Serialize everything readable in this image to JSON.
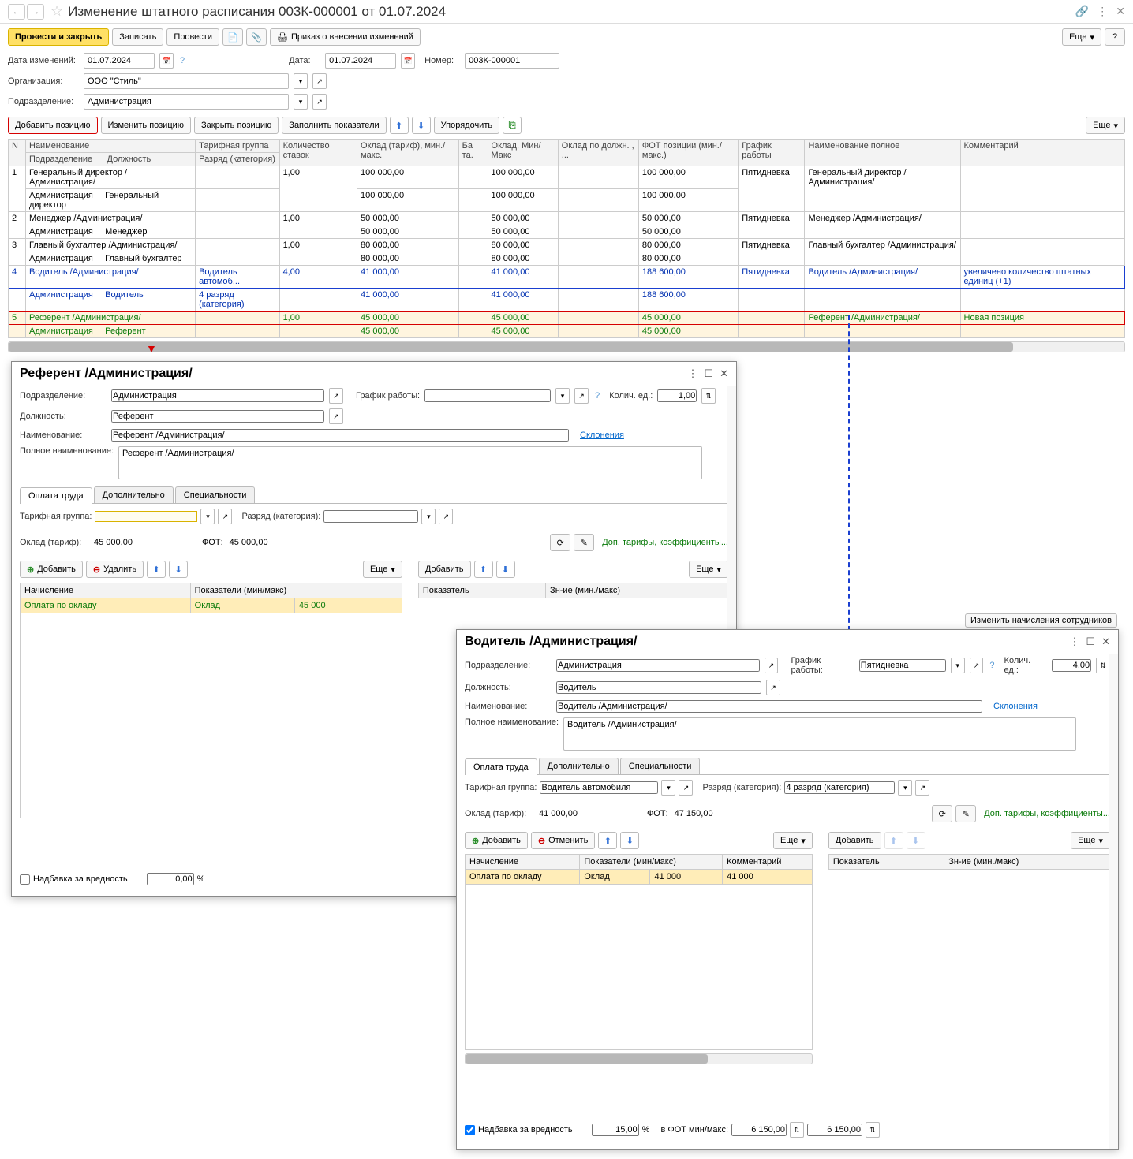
{
  "title": "Изменение штатного расписания 003К-000001 от 01.07.2024",
  "toolbar": {
    "post_close": "Провести и закрыть",
    "save": "Записать",
    "post": "Провести",
    "order": "Приказ о внесении изменений",
    "more": "Еще"
  },
  "fields": {
    "date_change_lbl": "Дата изменений:",
    "date_change_val": "01.07.2024",
    "date_lbl": "Дата:",
    "date_val": "01.07.2024",
    "number_lbl": "Номер:",
    "number_val": "003К-000001",
    "org_lbl": "Организация:",
    "org_val": "ООО \"Стиль\"",
    "dept_lbl": "Подразделение:",
    "dept_val": "Администрация"
  },
  "tb2": {
    "add_pos": "Добавить позицию",
    "edit_pos": "Изменить позицию",
    "close_pos": "Закрыть позицию",
    "fill_ind": "Заполнить показатели",
    "order": "Упорядочить",
    "more": "Еще"
  },
  "grid_head": {
    "n": "N",
    "name": "Наименование",
    "tariff": "Тарифная группа",
    "rates": "Количество ставок",
    "salary": "Оклад (тариф), мин./макс.",
    "base": "Ба та.",
    "sal_mm": "Оклад, Мин/Макс",
    "sal_pos": "Оклад по должн. , ...",
    "fot": "ФОТ позиции (мин./макс.)",
    "schedule": "График работы",
    "fullname": "Наименование полное",
    "comment": "Комментарий",
    "dept": "Подразделение",
    "position": "Должность",
    "rank": "Разряд (категория)"
  },
  "rows": [
    {
      "n": "1",
      "name": "Генеральный директор /Администрация/",
      "dept": "Администрация",
      "pos": "Генеральный директор",
      "rates": "1,00",
      "salary": "100 000,00",
      "salmm": "100 000,00",
      "salmm2": "100 000,00",
      "fot": "100 000,00",
      "fot2": "100 000,00",
      "sched": "Пятидневка",
      "full": "Генеральный директор /Администрация/",
      "comment": ""
    },
    {
      "n": "2",
      "name": "Менеджер /Администрация/",
      "dept": "Администрация",
      "pos": "Менеджер",
      "rates": "1,00",
      "salary": "50 000,00",
      "salmm": "50 000,00",
      "salmm2": "50 000,00",
      "fot": "50 000,00",
      "fot2": "50 000,00",
      "sched": "Пятидневка",
      "full": "Менеджер /Администрация/",
      "comment": ""
    },
    {
      "n": "3",
      "name": "Главный бухгалтер /Администрация/",
      "dept": "Администрация",
      "pos": "Главный бухгалтер",
      "rates": "1,00",
      "salary": "80 000,00",
      "salmm": "80 000,00",
      "salmm2": "80 000,00",
      "fot": "80 000,00",
      "fot2": "80 000,00",
      "sched": "Пятидневка",
      "full": "Главный бухгалтер /Администрация/",
      "comment": ""
    },
    {
      "n": "4",
      "name": "Водитель /Администрация/",
      "dept": "Администрация",
      "pos": "Водитель",
      "tariff": "Водитель автомоб...",
      "rank": "4 разряд (категория)",
      "rates": "4,00",
      "salary": "41 000,00",
      "salmm": "41 000,00",
      "salmm2": "41 000,00",
      "fot": "188 600,00",
      "fot2": "188 600,00",
      "sched": "Пятидневка",
      "full": "Водитель /Администрация/",
      "comment": "увеличено количество штатных единиц (+1)"
    },
    {
      "n": "5",
      "name": "Референт /Администрация/",
      "dept": "Администрация",
      "pos": "Референт",
      "rates": "1,00",
      "salary": "45 000,00",
      "salmm": "45 000,00",
      "salmm2": "45 000,00",
      "fot": "45 000,00",
      "fot2": "45 000,00",
      "sched": "",
      "full": "Референт /Администрация/",
      "comment": "Новая позиция"
    }
  ],
  "side_btn": "Изменить начисления сотрудников",
  "panel_ref": {
    "title": "Референт /Администрация/",
    "dept_lbl": "Подразделение:",
    "dept_val": "Администрация",
    "sched_lbl": "График работы:",
    "sched_val": "",
    "qty_lbl": "Колич. ед.:",
    "qty_val": "1,00",
    "pos_lbl": "Должность:",
    "pos_val": "Референт",
    "name_lbl": "Наименование:",
    "name_val": "Референт /Администрация/",
    "fullname_lbl": "Полное наименование:",
    "fullname_val": "Референт /Администрация/",
    "declensions": "Склонения",
    "tabs": [
      "Оплата труда",
      "Дополнительно",
      "Специальности"
    ],
    "tariff_lbl": "Тарифная группа:",
    "tariff_val": "",
    "rank_lbl": "Разряд (категория):",
    "rank_val": "",
    "salary_lbl": "Оклад (тариф):",
    "salary_val": "45 000,00",
    "fot_lbl": "ФОТ:",
    "fot_val": "45 000,00",
    "add": "Добавить",
    "del": "Удалить",
    "more": "Еще",
    "acc_lbl": "Начисление",
    "ind_lbl": "Показатели (мин/макс)",
    "acc_row": "Оплата по окладу",
    "ind_row": "Оклад",
    "ind_val": "45 000",
    "extra_hint": "Доп. тарифы, коэффициенты...",
    "ind2": "Показатель",
    "val2": "Зн-ие (мин./макс)",
    "harm_lbl": "Надбавка за вредность",
    "harm_val": "0,00",
    "pct": "%"
  },
  "panel_drv": {
    "title": "Водитель /Администрация/",
    "dept_lbl": "Подразделение:",
    "dept_val": "Администрация",
    "sched_lbl": "График работы:",
    "sched_val": "Пятидневка",
    "qty_lbl": "Колич. ед.:",
    "qty_val": "4,00",
    "pos_lbl": "Должность:",
    "pos_val": "Водитель",
    "name_lbl": "Наименование:",
    "name_val": "Водитель /Администрация/",
    "fullname_lbl": "Полное наименование:",
    "fullname_val": "Водитель /Администрация/",
    "declensions": "Склонения",
    "tabs": [
      "Оплата труда",
      "Дополнительно",
      "Специальности"
    ],
    "tariff_lbl": "Тарифная группа:",
    "tariff_val": "Водитель автомобиля",
    "rank_lbl": "Разряд (категория):",
    "rank_val": "4 разряд (категория)",
    "salary_lbl": "Оклад (тариф):",
    "salary_val": "41 000,00",
    "fot_lbl": "ФОТ:",
    "fot_val": "47 150,00",
    "add": "Добавить",
    "cancel": "Отменить",
    "more": "Еще",
    "acc_lbl": "Начисление",
    "ind_lbl": "Показатели (мин/макс)",
    "com_lbl": "Комментарий",
    "acc_row": "Оплата по окладу",
    "ind_row": "Оклад",
    "ind_val": "41 000",
    "ind_val2": "41 000",
    "extra_hint": "Доп. тарифы, коэффициенты...",
    "ind2": "Показатель",
    "val2": "Зн-ие (мин./макс)",
    "harm_lbl": "Надбавка за вредность",
    "harm_val": "15,00",
    "pct": "%",
    "inFOT_lbl": "в ФОТ мин/макс:",
    "inFOT_v1": "6 150,00",
    "inFOT_v2": "6 150,00"
  }
}
